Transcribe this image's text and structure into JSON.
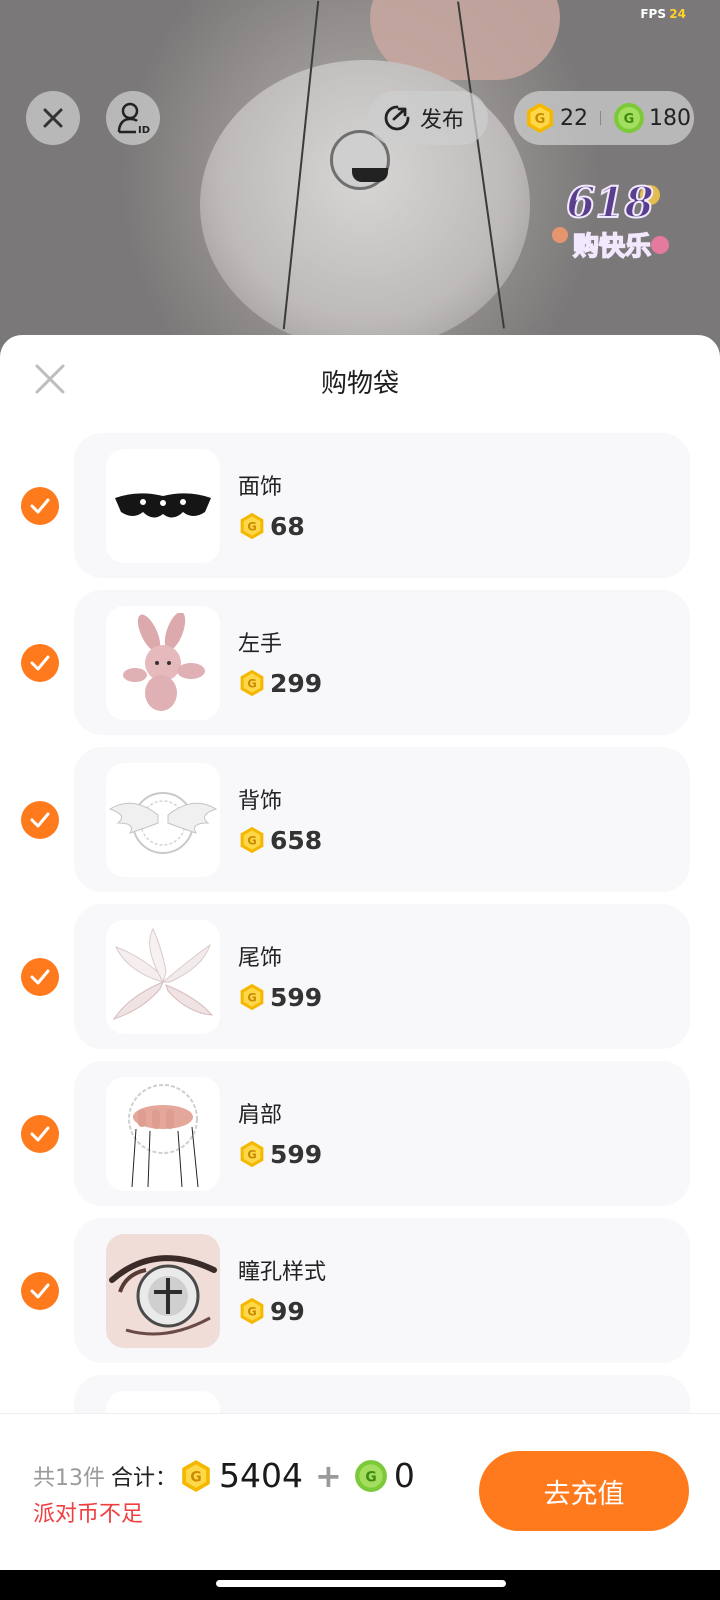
{
  "status": {
    "fps_label": "FPS",
    "fps_value": "24"
  },
  "topbar": {
    "publish_label": "发布",
    "gold_coins": "22",
    "green_coins": "180",
    "badge_number": "618",
    "badge_text": "购快乐"
  },
  "sheet": {
    "title": "购物袋",
    "items": [
      {
        "name": "面饰",
        "price": "68",
        "checked": true
      },
      {
        "name": "左手",
        "price": "299",
        "checked": true
      },
      {
        "name": "背饰",
        "price": "658",
        "checked": true
      },
      {
        "name": "尾饰",
        "price": "599",
        "checked": true
      },
      {
        "name": "肩部",
        "price": "599",
        "checked": true
      },
      {
        "name": "瞳孔样式",
        "price": "99",
        "checked": true
      }
    ]
  },
  "footer": {
    "count_text": "共13件",
    "sum_label": "合计：",
    "gold_total": "5404",
    "plus": "+",
    "green_total": "0",
    "warning": "派对币不足",
    "recharge_label": "去充值"
  },
  "colors": {
    "accent": "#ff7a1c",
    "warning": "#ef3f3f",
    "gold": "#f5b800",
    "green": "#7cc93a"
  }
}
